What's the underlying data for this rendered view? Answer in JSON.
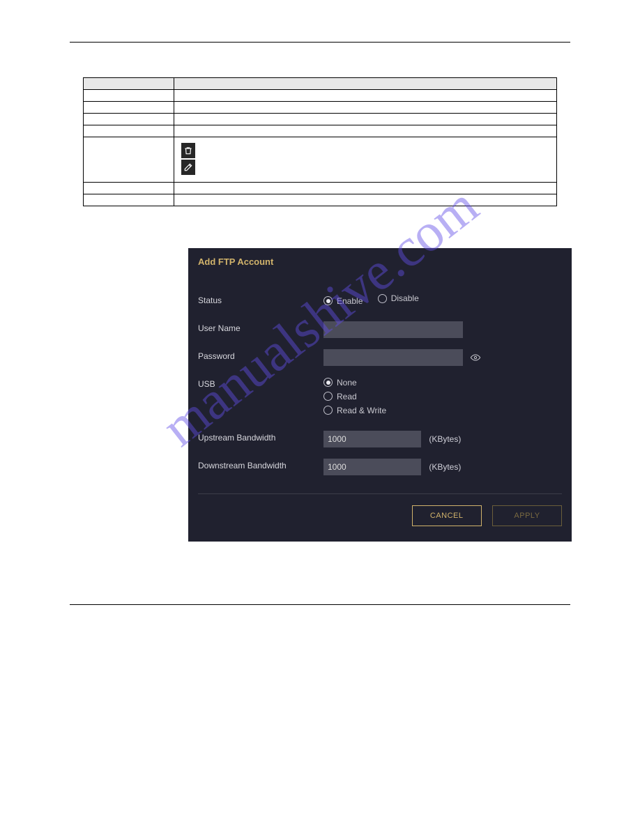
{
  "watermark_text": "manualshive.com",
  "table": {
    "headers": [
      "",
      ""
    ],
    "rows": [
      {
        "c0": " ",
        "c1": " "
      },
      {
        "c0": " ",
        "c1": " "
      },
      {
        "c0": " ",
        "c1": " "
      },
      {
        "c0": " ",
        "c1": " "
      },
      {
        "c0": " ",
        "c1_icons": [
          "trash-icon",
          "edit-icon"
        ],
        "c1": " "
      },
      {
        "c0": " ",
        "c1": " "
      },
      {
        "c0": " ",
        "c1": " "
      }
    ]
  },
  "dialog": {
    "title": "Add FTP Account",
    "fields": {
      "status": {
        "label": "Status",
        "options": {
          "enable": "Enable",
          "disable": "Disable"
        },
        "selected": "enable"
      },
      "username": {
        "label": "User Name",
        "value": ""
      },
      "password": {
        "label": "Password",
        "value": ""
      },
      "usb": {
        "label": "USB",
        "options": {
          "none": "None",
          "read": "Read",
          "rw": "Read & Write"
        },
        "selected": "none"
      },
      "upstream": {
        "label": "Upstream Bandwidth",
        "value": "1000",
        "unit": "(KBytes)"
      },
      "downstream": {
        "label": "Downstream Bandwidth",
        "value": "1000",
        "unit": "(KBytes)"
      }
    },
    "buttons": {
      "cancel": "CANCEL",
      "apply": "APPLY"
    }
  }
}
